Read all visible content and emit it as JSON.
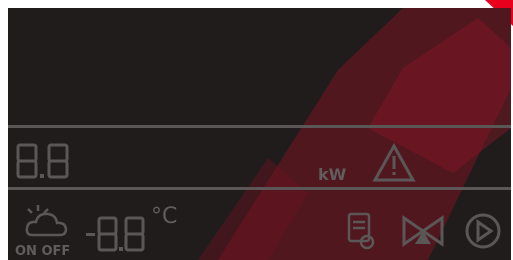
{
  "colors": {
    "background": "#201c1c",
    "segment": "#5b5757",
    "accent_red": "#b0182a",
    "corner_red": "#e8001d"
  },
  "display": {
    "main_value": "8.8",
    "power_unit": "kW",
    "temperature_value": "-8.8",
    "temperature_unit": "°C",
    "onoff_label": "ON OFF"
  },
  "icons": [
    "warning-icon",
    "weather-cloud-sun-icon",
    "schedule-icon",
    "valve-icon",
    "play-icon"
  ]
}
